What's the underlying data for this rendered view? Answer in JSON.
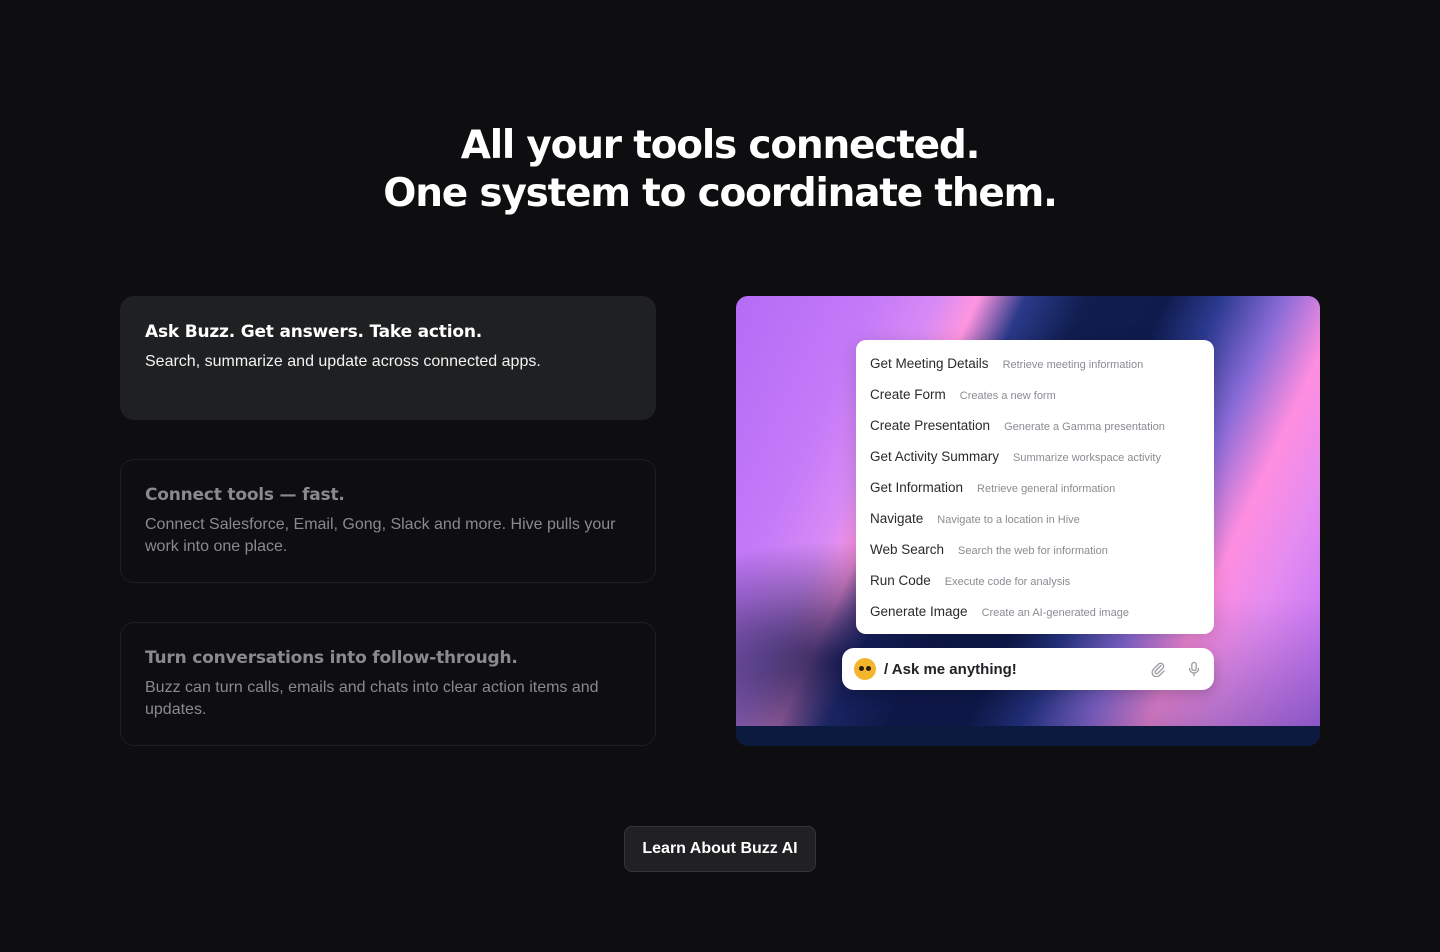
{
  "headline": {
    "line1": "All your tools connected.",
    "line2": "One system to coordinate them."
  },
  "features": [
    {
      "title": "Ask Buzz. Get answers. Take action.",
      "description": "Search, summarize and update across connected apps.",
      "active": true
    },
    {
      "title": "Connect tools — fast.",
      "description": "Connect Salesforce, Email, Gong, Slack and more. Hive pulls your work into one place.",
      "active": false
    },
    {
      "title": "Turn conversations into follow-through.",
      "description": "Buzz can turn calls, emails and chats into clear action items and updates.",
      "active": false
    }
  ],
  "command_menu": [
    {
      "name": "Get Meeting Details",
      "desc": "Retrieve meeting information"
    },
    {
      "name": "Create Form",
      "desc": "Creates a new form"
    },
    {
      "name": "Create Presentation",
      "desc": "Generate a Gamma presentation"
    },
    {
      "name": "Get Activity Summary",
      "desc": "Summarize workspace activity"
    },
    {
      "name": "Get Information",
      "desc": "Retrieve general information"
    },
    {
      "name": "Navigate",
      "desc": "Navigate to a location in Hive"
    },
    {
      "name": "Web Search",
      "desc": "Search the web for information"
    },
    {
      "name": "Run Code",
      "desc": "Execute code for analysis"
    },
    {
      "name": "Generate Image",
      "desc": "Create an AI-generated image"
    }
  ],
  "ask_bar": {
    "text": "/ Ask me anything!",
    "icons": [
      "bee-avatar-icon",
      "paperclip-icon",
      "microphone-icon"
    ]
  },
  "cta": {
    "label": "Learn About Buzz AI"
  },
  "colors": {
    "background": "#0e0e10",
    "active_card": "#1f2021",
    "muted_text": "#8a8a8e",
    "button_bg": "#212124"
  }
}
